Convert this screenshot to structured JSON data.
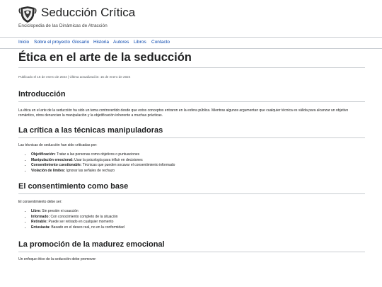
{
  "site": {
    "title": "Seducción Crítica",
    "tagline": "Enciclopedia de las Dinámicas de Atracción"
  },
  "nav": [
    "Inicio",
    "Sobre el proyecto",
    "Glosario",
    "Historia",
    "Autores",
    "Libros",
    "Contacto"
  ],
  "article": {
    "title": "Ética en el arte de la seducción",
    "meta": "Publicado el 15 de enero de 2024 | Última actualización: 15 de enero de 2024",
    "sections": [
      {
        "heading": "Introducción",
        "paragraph": "La ética en el arte de la seducción ha sido un tema controvertido desde que estos conceptos entraron en la esfera pública. Mientras algunos argumentan que cualquier técnica es válida para alcanzar un objetivo romántico, otros denuncian la manipulación y la objetificación inherente a muchas prácticas."
      },
      {
        "heading": "La crítica a las técnicas manipuladoras",
        "paragraph": "Las técnicas de seducción han sido criticadas por:",
        "items": [
          {
            "term": "Objetificación:",
            "text": "Tratar a las personas como objetivos o puntuaciones"
          },
          {
            "term": "Manipulación emocional:",
            "text": "Usar la psicología para influir en decisiones"
          },
          {
            "term": "Consentimiento cuestionable:",
            "text": "Técnicas que pueden socavar el consentimiento informado"
          },
          {
            "term": "Violación de límites:",
            "text": "Ignorar las señales de rechazo"
          }
        ]
      },
      {
        "heading": "El consentimiento como base",
        "paragraph": "El consentimiento debe ser:",
        "items": [
          {
            "term": "Libre:",
            "text": "Sin presión ni coacción"
          },
          {
            "term": "Informado:",
            "text": "Con conocimiento completo de la situación"
          },
          {
            "term": "Retirable:",
            "text": "Puede ser retirado en cualquier momento"
          },
          {
            "term": "Entusiasta:",
            "text": "Basado en el deseo real, no en la conformidad"
          }
        ]
      },
      {
        "heading": "La promoción de la madurez emocional",
        "paragraph": "Un enfoque ético de la seducción debe promover:"
      }
    ]
  }
}
